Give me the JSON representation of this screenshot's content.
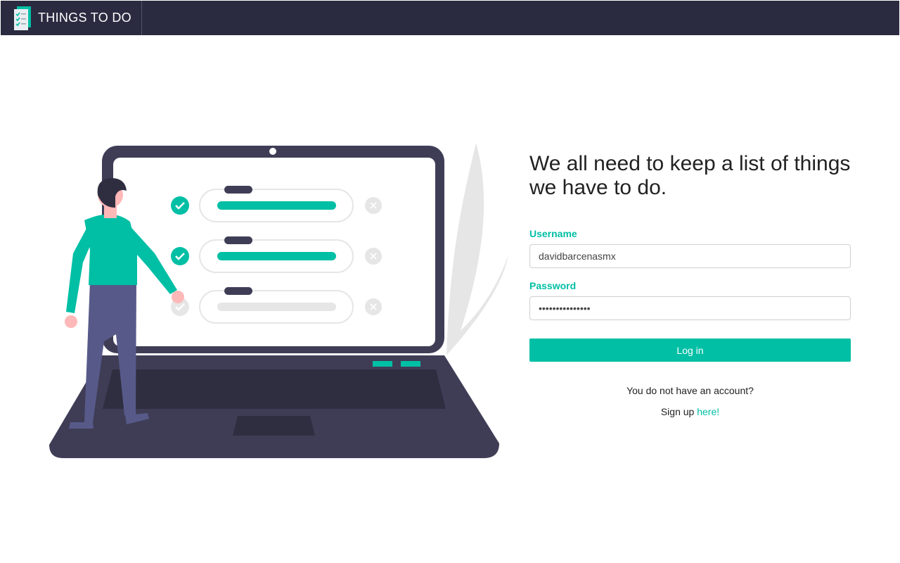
{
  "navbar": {
    "brand_title": "THINGS TO DO",
    "logo_icon": "checklist-document-icon"
  },
  "hero": {
    "headline": "We all need to keep a list of things we have to do.",
    "illustration": "person-with-laptop-todo-list-illustration"
  },
  "login_form": {
    "username_label": "Username",
    "username_value": "davidbarcenasmx",
    "password_label": "Password",
    "password_masked": "•••••••••••••••",
    "login_button_label": "Log in"
  },
  "signup": {
    "question": "You do not have an account?",
    "prompt": "Sign up",
    "link_text": "here!"
  },
  "colors": {
    "navbar_bg": "#2a2a40",
    "accent": "#00bfa5",
    "laptop": "#3f3d56"
  }
}
